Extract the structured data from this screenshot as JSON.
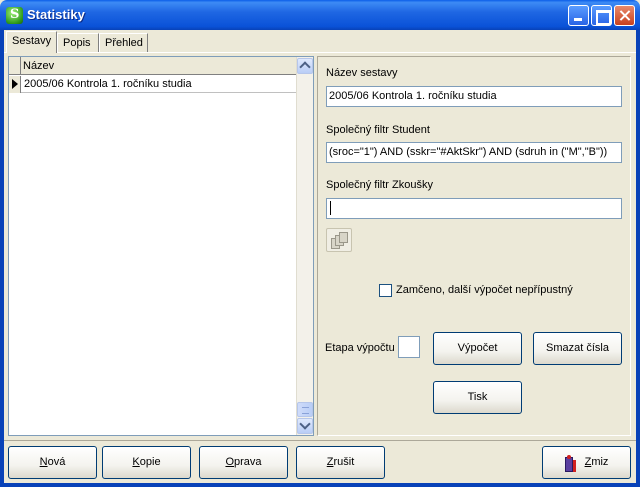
{
  "window": {
    "title": "Statistiky"
  },
  "tabs": [
    {
      "label": "Sestavy",
      "active": true
    },
    {
      "label": "Popis"
    },
    {
      "label": "Přehled"
    }
  ],
  "grid": {
    "column_header": "Název",
    "rows": [
      {
        "nazev": "2005/06 Kontrola 1. ročníku studia",
        "current": true
      }
    ]
  },
  "form": {
    "nazev_label": "Název sestavy",
    "nazev_value": "2005/06 Kontrola 1. ročníku studia",
    "filtr_student_label": "Společný filtr Student",
    "filtr_student_value": "(sroc=\"1\") AND (sskr=\"#AktSkr\") AND (sdruh in (\"M\",\"B\"))",
    "filtr_zkousky_label": "Společný filtr Zkoušky",
    "filtr_zkousky_value": "",
    "zamceno_label": "Zamčeno, další výpočet nepřípustný",
    "zamceno_checked": false,
    "etapa_label": "Etapa výpočtu",
    "etapa_value": ""
  },
  "buttons": {
    "vypocet": "Výpočet",
    "smazat": "Smazat čísla",
    "tisk": "Tisk"
  },
  "footer": {
    "nova_first": "N",
    "nova_rest": "ová",
    "kopie_first": "K",
    "kopie_rest": "opie",
    "oprava_first": "O",
    "oprava_rest": "prava",
    "zrusit_first": "Z",
    "zrusit_rest": "rušit",
    "zmiz_first": "Z",
    "zmiz_rest": "miz"
  },
  "colors": {
    "titlebar": "#0a52d8",
    "window_bg": "#ece9d8",
    "field_border": "#7f9db9",
    "button_border": "#003c74"
  }
}
